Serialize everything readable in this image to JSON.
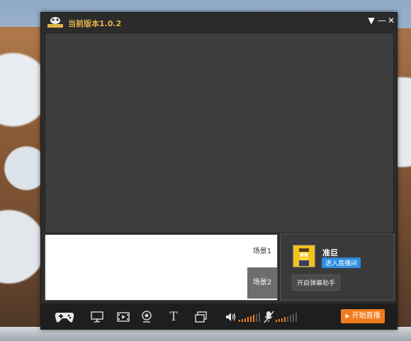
{
  "window": {
    "title": "当前版本1.0.2",
    "controls": {
      "dropdown": "▼",
      "minimize": "—",
      "close": "✕"
    }
  },
  "scenes": [
    {
      "label": "场景1"
    },
    {
      "label": "场景2"
    }
  ],
  "user": {
    "name": "准巨",
    "enter_room_label": "进入直播间",
    "danmu_helper_label": "开启弹幕助手"
  },
  "toolbar": {
    "icons": [
      "gamepad-icon",
      "monitor-icon",
      "video-icon",
      "camera-icon",
      "text-icon",
      "image-icon"
    ],
    "text_tool_label": "T",
    "start_live_label": "开始直播"
  },
  "colors": {
    "title": "#e0b44a",
    "enter_room_bg": "#2e8ce0",
    "start_button_bg": "#f07c1e",
    "meter_active": "#f07c1e"
  }
}
